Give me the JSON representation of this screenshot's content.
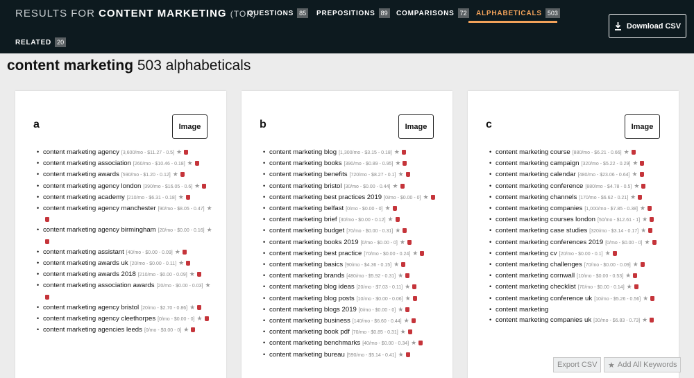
{
  "header": {
    "results_prefix": "RESULTS FOR",
    "query": "CONTENT MARKETING",
    "qualifier": "(TOP)",
    "tabs": [
      {
        "label": "QUESTIONS",
        "count": "85"
      },
      {
        "label": "PREPOSITIONS",
        "count": "89"
      },
      {
        "label": "COMPARISONS",
        "count": "72"
      },
      {
        "label": "ALPHABETICALS",
        "count": "503"
      },
      {
        "label": "RELATED",
        "count": "20"
      }
    ],
    "active_tab_color": "#f2a25a",
    "download_label": "Download CSV"
  },
  "page": {
    "keyword": "content marketing",
    "subtitle": "503 alphabeticals"
  },
  "image_button_label": "Image",
  "cards": [
    {
      "letter": "a",
      "items": [
        {
          "kw": "content marketing agency",
          "meta": "[3,600/mo - $11.27 - 0.5]"
        },
        {
          "kw": "content marketing association",
          "meta": "[260/mo - $10.46 - 0.18]"
        },
        {
          "kw": "content marketing awards",
          "meta": "[590/mo - $1.20 - 0.12]"
        },
        {
          "kw": "content marketing agency london",
          "meta": "[390/mo - $16.05 - 0.6]"
        },
        {
          "kw": "content marketing academy",
          "meta": "[210/mo - $6.31 - 0.18]"
        },
        {
          "kw": "content marketing agency manchester",
          "meta": "[90/mo - $8.05 - 0.47]"
        },
        {
          "kw": "content marketing agency birmingham",
          "meta": "[20/mo - $0.00 - 0.16]"
        },
        {
          "kw": "content marketing assistant",
          "meta": "[40/mo - $0.00 - 0.09]"
        },
        {
          "kw": "content marketing awards uk",
          "meta": "[20/mo - $0.00 - 0.11]"
        },
        {
          "kw": "content marketing awards 2018",
          "meta": "[210/mo - $0.00 - 0.09]"
        },
        {
          "kw": "content marketing association awards",
          "meta": "[20/mo - $0.00 - 0.03]"
        },
        {
          "kw": "content marketing agency bristol",
          "meta": "[20/mo - $2.70 - 0.86]"
        },
        {
          "kw": "content marketing agency cleethorpes",
          "meta": "[0/mo - $0.00 - 0]"
        },
        {
          "kw": "content marketing agencies leeds",
          "meta": "[0/mo - $0.00 - 0]"
        }
      ]
    },
    {
      "letter": "b",
      "items": [
        {
          "kw": "content marketing blog",
          "meta": "[1,300/mo - $3.15 - 0.18]"
        },
        {
          "kw": "content marketing books",
          "meta": "[390/mo - $0.89 - 0.95]"
        },
        {
          "kw": "content marketing benefits",
          "meta": "[720/mo - $8.27 - 0.1]"
        },
        {
          "kw": "content marketing bristol",
          "meta": "[30/mo - $0.00 - 0.44]"
        },
        {
          "kw": "content marketing best practices 2019",
          "meta": "[0/mo - $0.00 - 0]"
        },
        {
          "kw": "content marketing belfast",
          "meta": "[0/mo - $0.00 - 0]"
        },
        {
          "kw": "content marketing brief",
          "meta": "[30/mo - $0.00 - 0.12]"
        },
        {
          "kw": "content marketing budget",
          "meta": "[70/mo - $0.00 - 0.31]"
        },
        {
          "kw": "content marketing books 2019",
          "meta": "[0/mo - $0.00 - 0]"
        },
        {
          "kw": "content marketing best practice",
          "meta": "[70/mo - $0.00 - 0.24]"
        },
        {
          "kw": "content marketing basics",
          "meta": "[90/mo - $4.36 - 0.15]"
        },
        {
          "kw": "content marketing brands",
          "meta": "[480/mo - $5.92 - 0.31]"
        },
        {
          "kw": "content marketing blog ideas",
          "meta": "[20/mo - $7.03 - 0.11]"
        },
        {
          "kw": "content marketing blog posts",
          "meta": "[10/mo - $0.00 - 0.06]"
        },
        {
          "kw": "content marketing blogs 2019",
          "meta": "[0/mo - $0.00 - 0]"
        },
        {
          "kw": "content marketing business",
          "meta": "[140/mo - $6.60 - 0.44]"
        },
        {
          "kw": "content marketing book pdf",
          "meta": "[70/mo - $0.85 - 0.31]"
        },
        {
          "kw": "content marketing benchmarks",
          "meta": "[40/mo - $0.00 - 0.34]"
        },
        {
          "kw": "content marketing bureau",
          "meta": "[590/mo - $5.14 - 0.41]"
        }
      ]
    },
    {
      "letter": "c",
      "items": [
        {
          "kw": "content marketing course",
          "meta": "[880/mo - $6.21 - 0.66]"
        },
        {
          "kw": "content marketing campaign",
          "meta": "[320/mo - $5.22 - 0.29]"
        },
        {
          "kw": "content marketing calendar",
          "meta": "[480/mo - $23.06 - 0.64]"
        },
        {
          "kw": "content marketing conference",
          "meta": "[880/mo - $4.78 - 0.5]"
        },
        {
          "kw": "content marketing channels",
          "meta": "[170/mo - $6.62 - 0.21]"
        },
        {
          "kw": "content marketing companies",
          "meta": "[1,000/mo - $7.85 - 0.38]"
        },
        {
          "kw": "content marketing courses london",
          "meta": "[50/mo - $12.61 - 1]"
        },
        {
          "kw": "content marketing case studies",
          "meta": "[320/mo - $3.14 - 0.17]"
        },
        {
          "kw": "content marketing conferences 2019",
          "meta": "[0/mo - $0.00 - 0]"
        },
        {
          "kw": "content marketing cv",
          "meta": "[20/mo - $0.00 - 0.1]"
        },
        {
          "kw": "content marketing challenges",
          "meta": "[70/mo - $0.00 - 0.09]"
        },
        {
          "kw": "content marketing cornwall",
          "meta": "[10/mo - $0.00 - 0.53]"
        },
        {
          "kw": "content marketing checklist",
          "meta": "[70/mo - $0.00 - 0.14]"
        },
        {
          "kw": "content marketing conference uk",
          "meta": "[10/mo - $5.26 - 0.56]"
        },
        {
          "kw": "content marketing",
          "meta": ""
        },
        {
          "kw": "content marketing companies uk",
          "meta": "[30/mo - $6.83 - 0.73]"
        }
      ]
    }
  ],
  "footer_buttons": {
    "export_label": "Export CSV",
    "add_all_label": "Add All Keywords"
  }
}
